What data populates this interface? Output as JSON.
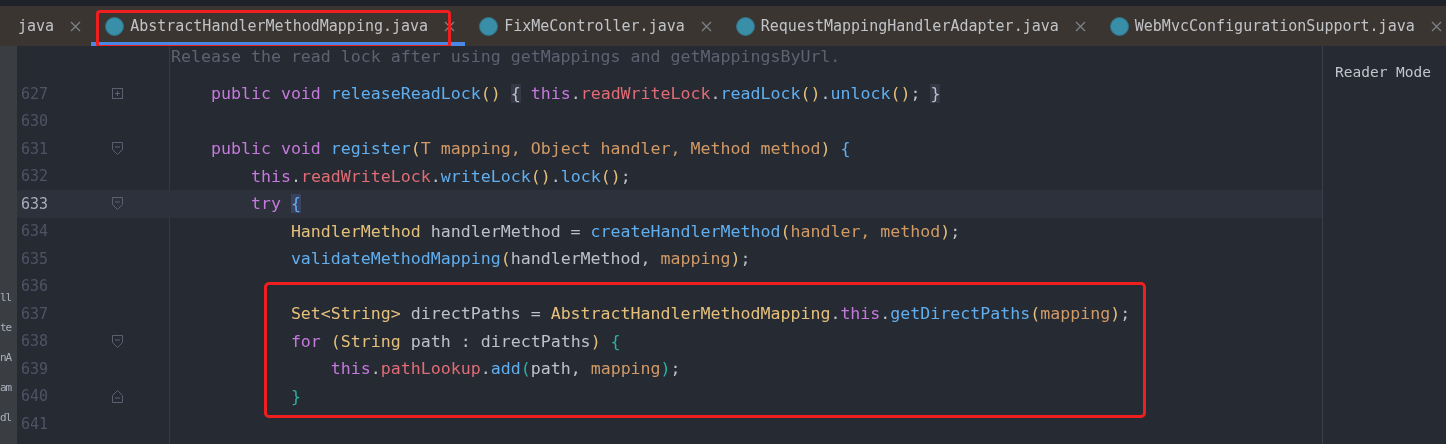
{
  "tabs": [
    {
      "label": "java",
      "selected": false,
      "icon": false,
      "annotated": false
    },
    {
      "label": "AbstractHandlerMethodMapping.java",
      "selected": true,
      "icon": true,
      "annotated": true
    },
    {
      "label": "FixMeController.java",
      "selected": false,
      "icon": true,
      "annotated": false
    },
    {
      "label": "RequestMappingHandlerAdapter.java",
      "selected": false,
      "icon": true,
      "annotated": false
    },
    {
      "label": "WebMvcConfigurationSupport.java",
      "selected": false,
      "icon": true,
      "annotated": false
    }
  ],
  "side_fragments": [
    "ll",
    "te",
    "nA",
    "am",
    "dl"
  ],
  "doc_comment": "Release the read lock after using getMappings and getMappingsByUrl.",
  "lines": [
    {
      "number": "627",
      "current": false,
      "kind": "collapsed",
      "annotated": false,
      "tokens": [
        {
          "t": "    public void ",
          "kind": "kw"
        },
        {
          "t": "releaseReadLock",
          "kind": "fn"
        },
        {
          "t": "() ",
          "kind": "paren"
        },
        {
          "t": "{",
          "kind": "folded"
        },
        {
          "t": " this",
          "kind": "kw"
        },
        {
          "t": ".",
          "kind": "plain"
        },
        {
          "t": "readWriteLock",
          "kind": "field"
        },
        {
          "t": ".",
          "kind": "plain"
        },
        {
          "t": "readLock",
          "kind": "fn"
        },
        {
          "t": "()",
          "kind": "paren"
        },
        {
          "t": ".",
          "kind": "plain"
        },
        {
          "t": "unlock",
          "kind": "fn"
        },
        {
          "t": "()",
          "kind": "paren"
        },
        {
          "t": "; ",
          "kind": "plain"
        },
        {
          "t": "}",
          "kind": "folded"
        }
      ]
    },
    {
      "number": "630",
      "current": false,
      "kind": "plain",
      "annotated": false
    },
    {
      "number": "631",
      "current": false,
      "kind": "fold-start",
      "annotated": false,
      "tokens": [
        {
          "t": "    public void ",
          "kind": "kw"
        },
        {
          "t": "register",
          "kind": "fn"
        },
        {
          "t": "(",
          "kind": "paren"
        },
        {
          "t": "T mapping, Object handler, Method method",
          "kind": "param"
        },
        {
          "t": ") ",
          "kind": "paren"
        },
        {
          "t": "{",
          "kind": "brace"
        }
      ]
    },
    {
      "number": "632",
      "current": false,
      "kind": "plain",
      "annotated": false,
      "tokens": [
        {
          "t": "        this",
          "kind": "kw"
        },
        {
          "t": ".",
          "kind": "plain"
        },
        {
          "t": "readWriteLock",
          "kind": "field"
        },
        {
          "t": ".",
          "kind": "plain"
        },
        {
          "t": "writeLock",
          "kind": "fn"
        },
        {
          "t": "()",
          "kind": "paren"
        },
        {
          "t": ".",
          "kind": "plain"
        },
        {
          "t": "lock",
          "kind": "fn"
        },
        {
          "t": "()",
          "kind": "paren"
        },
        {
          "t": ";",
          "kind": "plain"
        }
      ]
    },
    {
      "number": "633",
      "current": true,
      "kind": "fold-start",
      "annotated": false,
      "tokens": [
        {
          "t": "        try ",
          "kind": "kw"
        },
        {
          "t": "{",
          "kind": "matched"
        }
      ]
    },
    {
      "number": "634",
      "current": false,
      "kind": "plain",
      "annotated": false,
      "tokens": [
        {
          "t": "            HandlerMethod",
          "kind": "type"
        },
        {
          "t": " handlerMethod = ",
          "kind": "plain"
        },
        {
          "t": "createHandlerMethod",
          "kind": "fn"
        },
        {
          "t": "(",
          "kind": "paren"
        },
        {
          "t": "handler, method",
          "kind": "param"
        },
        {
          "t": ")",
          "kind": "paren"
        },
        {
          "t": ";",
          "kind": "plain"
        }
      ]
    },
    {
      "number": "635",
      "current": false,
      "kind": "plain",
      "annotated": false,
      "tokens": [
        {
          "t": "            validateMethodMapping",
          "kind": "fn"
        },
        {
          "t": "(",
          "kind": "paren"
        },
        {
          "t": "handlerMethod, ",
          "kind": "plain"
        },
        {
          "t": "mapping",
          "kind": "param"
        },
        {
          "t": ")",
          "kind": "paren"
        },
        {
          "t": ";",
          "kind": "plain"
        }
      ]
    },
    {
      "number": "636",
      "current": false,
      "kind": "plain",
      "annotated": true
    },
    {
      "number": "637",
      "current": false,
      "kind": "plain",
      "annotated": true,
      "tokens": [
        {
          "t": "            Set<String>",
          "kind": "type"
        },
        {
          "t": " directPaths = ",
          "kind": "plain"
        },
        {
          "t": "AbstractHandlerMethodMapping",
          "kind": "type"
        },
        {
          "t": ".",
          "kind": "plain"
        },
        {
          "t": "this",
          "kind": "kw"
        },
        {
          "t": ".",
          "kind": "plain"
        },
        {
          "t": "getDirectPaths",
          "kind": "fn"
        },
        {
          "t": "(",
          "kind": "paren"
        },
        {
          "t": "mapping",
          "kind": "param"
        },
        {
          "t": ")",
          "kind": "paren"
        },
        {
          "t": ";",
          "kind": "plain"
        }
      ]
    },
    {
      "number": "638",
      "current": false,
      "kind": "fold-start",
      "annotated": true,
      "tokens": [
        {
          "t": "            for ",
          "kind": "kw"
        },
        {
          "t": "(String",
          "kind": "type"
        },
        {
          "t": " path : directPaths",
          "kind": "plain"
        },
        {
          "t": ") ",
          "kind": "paren"
        },
        {
          "t": "{",
          "kind": "teal"
        }
      ]
    },
    {
      "number": "639",
      "current": false,
      "kind": "plain",
      "annotated": true,
      "tokens": [
        {
          "t": "                this",
          "kind": "kw"
        },
        {
          "t": ".",
          "kind": "plain"
        },
        {
          "t": "pathLookup",
          "kind": "field"
        },
        {
          "t": ".",
          "kind": "plain"
        },
        {
          "t": "add",
          "kind": "fn"
        },
        {
          "t": "(",
          "kind": "teal"
        },
        {
          "t": "path, ",
          "kind": "plain"
        },
        {
          "t": "mapping",
          "kind": "param"
        },
        {
          "t": ")",
          "kind": "teal"
        },
        {
          "t": ";",
          "kind": "plain"
        }
      ]
    },
    {
      "number": "640",
      "current": false,
      "kind": "fold-end",
      "annotated": true,
      "tokens": [
        {
          "t": "            }",
          "kind": "teal"
        }
      ]
    },
    {
      "number": "641",
      "current": false,
      "kind": "plain",
      "annotated": false
    }
  ],
  "side_panel": {
    "title": "Reader Mode"
  }
}
